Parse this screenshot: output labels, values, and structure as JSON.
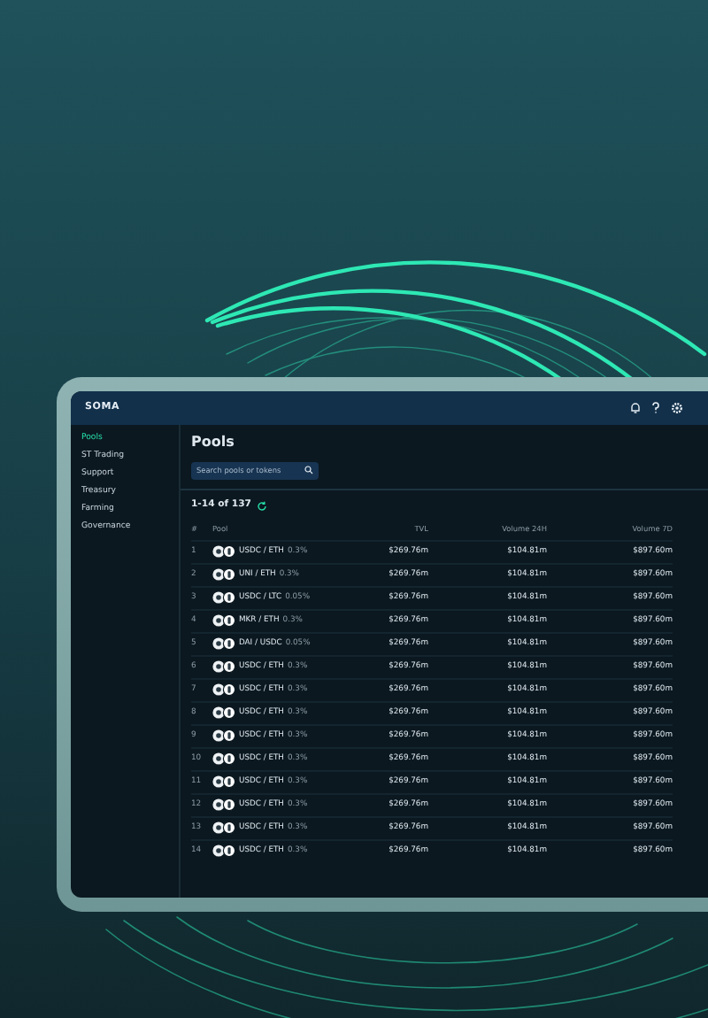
{
  "app": {
    "brand": "SOMA"
  },
  "sidebar": {
    "items": [
      {
        "label": "Pools",
        "selected": true
      },
      {
        "label": "ST Trading",
        "selected": false
      },
      {
        "label": "Support",
        "selected": false
      },
      {
        "label": "Treasury",
        "selected": false
      },
      {
        "label": "Farming",
        "selected": false
      },
      {
        "label": "Governance",
        "selected": false
      }
    ]
  },
  "page": {
    "title": "Pools",
    "search": {
      "placeholder": "Search pools or tokens"
    },
    "count": "1-14 of 137"
  },
  "table": {
    "columns": [
      "#",
      "Pool",
      "TVL",
      "Volume 24H",
      "Volume 7D"
    ],
    "rows": [
      {
        "index": "1",
        "pair": "USDC / ETH",
        "fee": "0.3%",
        "tvl": "$269.76m",
        "volume_24h": "$104.81m",
        "volume_7d": "$897.60m"
      },
      {
        "index": "2",
        "pair": "UNI / ETH",
        "fee": "0.3%",
        "tvl": "$269.76m",
        "volume_24h": "$104.81m",
        "volume_7d": "$897.60m"
      },
      {
        "index": "3",
        "pair": "USDC / LTC",
        "fee": "0.05%",
        "tvl": "$269.76m",
        "volume_24h": "$104.81m",
        "volume_7d": "$897.60m"
      },
      {
        "index": "4",
        "pair": "MKR / ETH",
        "fee": "0.3%",
        "tvl": "$269.76m",
        "volume_24h": "$104.81m",
        "volume_7d": "$897.60m"
      },
      {
        "index": "5",
        "pair": "DAI / USDC",
        "fee": "0.05%",
        "tvl": "$269.76m",
        "volume_24h": "$104.81m",
        "volume_7d": "$897.60m"
      },
      {
        "index": "6",
        "pair": "USDC / ETH",
        "fee": "0.3%",
        "tvl": "$269.76m",
        "volume_24h": "$104.81m",
        "volume_7d": "$897.60m"
      },
      {
        "index": "7",
        "pair": "USDC / ETH",
        "fee": "0.3%",
        "tvl": "$269.76m",
        "volume_24h": "$104.81m",
        "volume_7d": "$897.60m"
      },
      {
        "index": "8",
        "pair": "USDC / ETH",
        "fee": "0.3%",
        "tvl": "$269.76m",
        "volume_24h": "$104.81m",
        "volume_7d": "$897.60m"
      },
      {
        "index": "9",
        "pair": "USDC / ETH",
        "fee": "0.3%",
        "tvl": "$269.76m",
        "volume_24h": "$104.81m",
        "volume_7d": "$897.60m"
      },
      {
        "index": "10",
        "pair": "USDC / ETH",
        "fee": "0.3%",
        "tvl": "$269.76m",
        "volume_24h": "$104.81m",
        "volume_7d": "$897.60m"
      },
      {
        "index": "11",
        "pair": "USDC / ETH",
        "fee": "0.3%",
        "tvl": "$269.76m",
        "volume_24h": "$104.81m",
        "volume_7d": "$897.60m"
      },
      {
        "index": "12",
        "pair": "USDC / ETH",
        "fee": "0.3%",
        "tvl": "$269.76m",
        "volume_24h": "$104.81m",
        "volume_7d": "$897.60m"
      },
      {
        "index": "13",
        "pair": "USDC / ETH",
        "fee": "0.3%",
        "tvl": "$269.76m",
        "volume_24h": "$104.81m",
        "volume_7d": "$897.60m"
      },
      {
        "index": "14",
        "pair": "USDC / ETH",
        "fee": "0.3%",
        "tvl": "$269.76m",
        "volume_24h": "$104.81m",
        "volume_7d": "$897.60m"
      }
    ]
  }
}
